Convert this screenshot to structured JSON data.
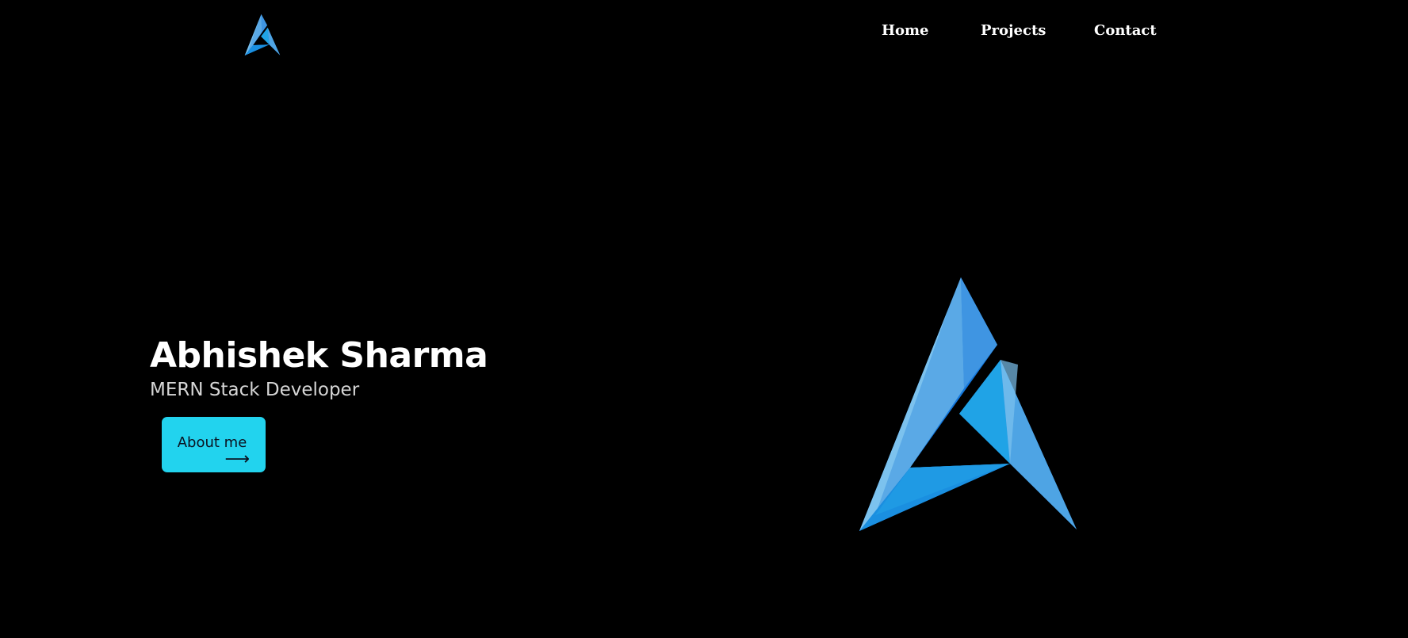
{
  "nav": {
    "logo_icon": "brand-logo-triangle-icon",
    "links": [
      {
        "label": "Home"
      },
      {
        "label": "Projects"
      },
      {
        "label": "Contact"
      }
    ]
  },
  "hero": {
    "name": "Abhishek Sharma",
    "role": "MERN Stack Developer",
    "button_label": "About me",
    "button_icon": "arrow-right-icon",
    "button_arrow": "⟶",
    "logo_icon": "brand-logo-triangle-icon"
  },
  "colors": {
    "background": "#000000",
    "text": "#ffffff",
    "accent_button": "#22d3ee",
    "logo_dark_blue": "#1477dc",
    "logo_light_blue": "#5aa9e6"
  }
}
